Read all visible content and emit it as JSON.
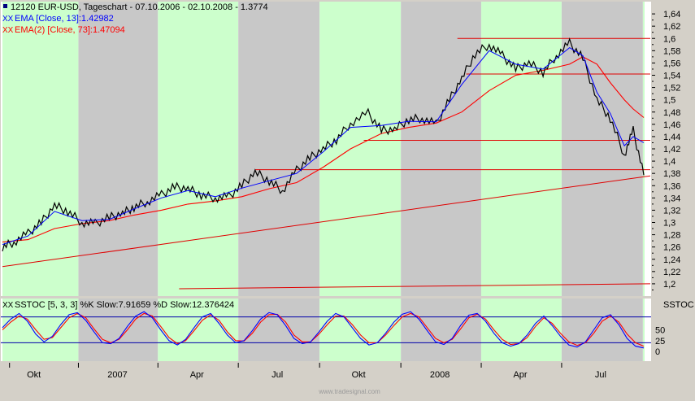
{
  "legend": {
    "title": "12120  EUR-USD, Tageschart - 07.10.2006 - 02.10.2008 - 1.3774",
    "ema13": "EMA [Close, 13]:1.42982",
    "ema73": "EMA(2) [Close, 73]:1.47094",
    "sstoc": "SSTOC [5, 3, 3] %K Slow:7.91659 %D Slow:12.376424",
    "marker_xx": "XX"
  },
  "right_panel_label": "SSTOC",
  "watermark": "www.tradesignal.com",
  "colors": {
    "price": "#000000",
    "ema13": "#0000ff",
    "ema73": "#ff0000",
    "trendline": "#e00000",
    "stoch_k": "#0000ff",
    "stoch_d": "#ff0000",
    "band_green": "#ccffcc",
    "band_gray": "#c8c8c8",
    "plot_bg": "#ffffff",
    "frame_bg": "#d4d0c8"
  },
  "chart_data": [
    {
      "type": "line",
      "title": "12120  EUR-USD, Tageschart - 07.10.2006 - 02.10.2008 - 1.3774",
      "xlabel": "",
      "ylabel": "",
      "x_ticks": [
        "Okt",
        "2007",
        "Apr",
        "Jul",
        "Okt",
        "2008",
        "Apr",
        "Jul"
      ],
      "y_ticks": [
        "1,64",
        "1,62",
        "1,6",
        "1,58",
        "1,56",
        "1,54",
        "1,52",
        "1,5",
        "1,48",
        "1,46",
        "1,44",
        "1,42",
        "1,4",
        "1,38",
        "1,36",
        "1,34",
        "1,32",
        "1,3",
        "1,28",
        "1,26",
        "1,24",
        "1,22",
        "1,2"
      ],
      "ylim": [
        1.18,
        1.66
      ],
      "x_range": [
        "2006-10-07",
        "2008-10-02"
      ],
      "shaded_quarters": [
        "2006-10-07/2006-12-31",
        "2007-04-01/2007-06-30",
        "2007-10-01/2007-12-31",
        "2008-04-01/2008-06-30",
        "2008-10-01/2008-10-02"
      ],
      "series": [
        {
          "name": "EUR-USD",
          "x": [
            "2006-10-07",
            "2006-10-20",
            "2006-11-05",
            "2006-11-20",
            "2006-12-05",
            "2006-12-20",
            "2007-01-05",
            "2007-01-20",
            "2007-02-05",
            "2007-02-20",
            "2007-03-05",
            "2007-03-20",
            "2007-04-05",
            "2007-04-20",
            "2007-05-05",
            "2007-05-20",
            "2007-06-05",
            "2007-06-20",
            "2007-07-05",
            "2007-07-20",
            "2007-08-05",
            "2007-08-20",
            "2007-09-05",
            "2007-09-20",
            "2007-10-05",
            "2007-10-20",
            "2007-11-05",
            "2007-11-25",
            "2007-12-10",
            "2007-12-25",
            "2008-01-10",
            "2008-01-25",
            "2008-02-10",
            "2008-02-25",
            "2008-03-10",
            "2008-03-25",
            "2008-04-10",
            "2008-04-25",
            "2008-05-10",
            "2008-05-25",
            "2008-06-10",
            "2008-06-25",
            "2008-07-10",
            "2008-07-25",
            "2008-08-10",
            "2008-08-25",
            "2008-09-10",
            "2008-09-20",
            "2008-10-02"
          ],
          "values": [
            1.26,
            1.268,
            1.282,
            1.3,
            1.328,
            1.318,
            1.3,
            1.298,
            1.308,
            1.315,
            1.325,
            1.334,
            1.345,
            1.358,
            1.355,
            1.345,
            1.34,
            1.342,
            1.36,
            1.382,
            1.368,
            1.352,
            1.385,
            1.405,
            1.42,
            1.435,
            1.462,
            1.478,
            1.45,
            1.452,
            1.468,
            1.47,
            1.46,
            1.5,
            1.535,
            1.575,
            1.59,
            1.572,
            1.55,
            1.56,
            1.545,
            1.572,
            1.592,
            1.568,
            1.5,
            1.47,
            1.41,
            1.45,
            1.377
          ]
        },
        {
          "name": "EMA [Close, 13]",
          "x": [
            "2006-10-07",
            "2006-11-05",
            "2006-12-05",
            "2007-01-05",
            "2007-02-05",
            "2007-03-05",
            "2007-04-05",
            "2007-05-05",
            "2007-06-05",
            "2007-07-05",
            "2007-08-05",
            "2007-09-05",
            "2007-10-05",
            "2007-11-05",
            "2007-12-10",
            "2008-01-10",
            "2008-02-10",
            "2008-03-10",
            "2008-04-10",
            "2008-05-10",
            "2008-06-10",
            "2008-07-10",
            "2008-07-25",
            "2008-08-10",
            "2008-08-25",
            "2008-09-10",
            "2008-09-20",
            "2008-10-02"
          ],
          "values": [
            1.264,
            1.278,
            1.318,
            1.303,
            1.305,
            1.322,
            1.34,
            1.352,
            1.342,
            1.356,
            1.368,
            1.38,
            1.415,
            1.455,
            1.458,
            1.465,
            1.464,
            1.525,
            1.58,
            1.558,
            1.55,
            1.585,
            1.572,
            1.512,
            1.478,
            1.425,
            1.44,
            1.43
          ]
        },
        {
          "name": "EMA(2) [Close, 73]",
          "x": [
            "2006-10-07",
            "2006-11-05",
            "2006-12-05",
            "2007-01-05",
            "2007-02-05",
            "2007-03-05",
            "2007-04-05",
            "2007-05-05",
            "2007-06-05",
            "2007-07-05",
            "2007-08-05",
            "2007-09-05",
            "2007-10-05",
            "2007-11-05",
            "2007-12-10",
            "2008-01-10",
            "2008-02-10",
            "2008-03-10",
            "2008-04-10",
            "2008-05-10",
            "2008-06-10",
            "2008-07-10",
            "2008-07-25",
            "2008-08-10",
            "2008-08-25",
            "2008-09-10",
            "2008-09-20",
            "2008-10-02"
          ],
          "values": [
            1.268,
            1.272,
            1.29,
            1.298,
            1.303,
            1.312,
            1.32,
            1.33,
            1.335,
            1.342,
            1.355,
            1.365,
            1.39,
            1.42,
            1.445,
            1.455,
            1.462,
            1.48,
            1.515,
            1.54,
            1.548,
            1.558,
            1.57,
            1.558,
            1.528,
            1.5,
            1.485,
            1.471
          ]
        }
      ],
      "lines": [
        {
          "name": "long-term-trendline",
          "from": [
            "2006-10-07",
            1.228
          ],
          "to": [
            "2008-10-02",
            1.372
          ]
        },
        {
          "name": "horizontal-1.60",
          "from": [
            "2008-03-05",
            1.6
          ],
          "to": [
            "2008-10-02",
            1.6
          ]
        },
        {
          "name": "horizontal-1.542",
          "from": [
            "2008-03-15",
            1.542
          ],
          "to": [
            "2008-10-02",
            1.542
          ]
        },
        {
          "name": "horizontal-1.434",
          "from": [
            "2007-11-20",
            1.434
          ],
          "to": [
            "2008-10-02",
            1.434
          ]
        },
        {
          "name": "horizontal-1.386",
          "from": [
            "2007-07-20",
            1.386
          ],
          "to": [
            "2008-10-02",
            1.386
          ]
        },
        {
          "name": "lower-trendline",
          "from": [
            "2007-04-25",
            1.192
          ],
          "to": [
            "2008-10-02",
            1.2
          ]
        }
      ]
    },
    {
      "type": "line",
      "title": "SSTOC [5, 3, 3] %K Slow:7.91659 %D Slow:12.376424",
      "y_ticks": [
        "50",
        "25",
        "0"
      ],
      "ylim": [
        0,
        100
      ],
      "reference_levels": [
        80,
        20
      ],
      "x_range": [
        "2006-10-07",
        "2008-10-02"
      ],
      "series": [
        {
          "name": "%K Slow",
          "x_start": "2006-10-07",
          "x_end": "2008-10-02",
          "values": [
            55,
            75,
            88,
            70,
            40,
            22,
            35,
            62,
            85,
            90,
            72,
            45,
            20,
            18,
            30,
            58,
            82,
            92,
            78,
            50,
            25,
            15,
            28,
            55,
            80,
            88,
            65,
            38,
            20,
            25,
            48,
            75,
            90,
            85,
            60,
            30,
            18,
            22,
            45,
            70,
            88,
            80,
            55,
            30,
            15,
            20,
            42,
            68,
            86,
            92,
            75,
            48,
            22,
            16,
            30,
            60,
            84,
            88,
            70,
            42,
            20,
            12,
            18,
            38,
            65,
            82,
            60,
            35,
            15,
            10,
            22,
            50,
            78,
            85,
            62,
            30,
            12,
            8
          ]
        },
        {
          "name": "%D Slow",
          "x_start": "2006-10-07",
          "x_end": "2008-10-02",
          "values": [
            50,
            68,
            82,
            75,
            50,
            28,
            32,
            55,
            78,
            88,
            78,
            52,
            28,
            20,
            28,
            50,
            75,
            88,
            82,
            58,
            32,
            18,
            25,
            48,
            72,
            85,
            72,
            45,
            25,
            24,
            42,
            68,
            85,
            86,
            68,
            38,
            22,
            22,
            40,
            62,
            82,
            82,
            62,
            38,
            20,
            20,
            38,
            60,
            80,
            88,
            80,
            55,
            30,
            20,
            28,
            52,
            78,
            86,
            75,
            50,
            28,
            16,
            18,
            32,
            58,
            78,
            65,
            42,
            22,
            14,
            20,
            42,
            70,
            82,
            68,
            40,
            20,
            12
          ]
        }
      ]
    }
  ]
}
